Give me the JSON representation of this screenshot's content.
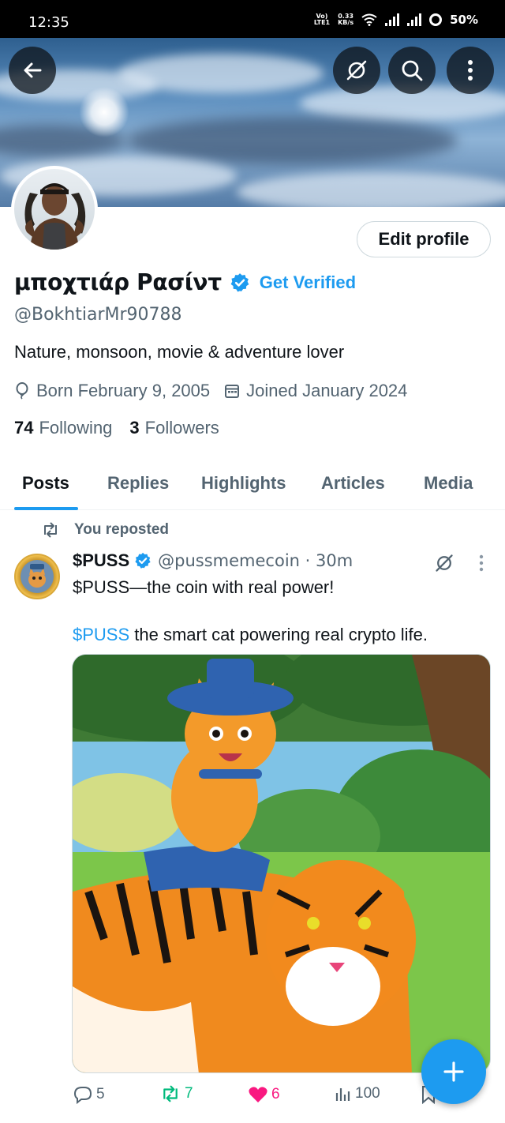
{
  "status_bar": {
    "time": "12:35",
    "network_top": "Vo)",
    "network_bottom": "LTE1",
    "speed_top": "0.33",
    "speed_bottom": "KB/s",
    "battery": "50%"
  },
  "header_buttons": {
    "back": "back-arrow-icon",
    "grok": "grok-icon",
    "search": "search-icon",
    "more": "more-vertical-icon"
  },
  "profile": {
    "edit_label": "Edit profile",
    "display_name": "μποχτιάρ Ρασίντ",
    "get_verified": "Get Verified",
    "handle": "@BokhtiarMr90788",
    "bio": "Nature, monsoon, movie & adventure lover",
    "born": "Born February 9, 2005",
    "joined": "Joined January 2024",
    "following_count": "74",
    "following_label": "Following",
    "followers_count": "3",
    "followers_label": "Followers"
  },
  "tabs": [
    "Posts",
    "Replies",
    "Highlights",
    "Articles",
    "Media"
  ],
  "post": {
    "repost_label": "You reposted",
    "author": "$PUSS",
    "handle_time": "@pussmemecoin · 30m",
    "text_line1": "$PUSS—the coin with real power!",
    "text_cashtag": "$PUSS",
    "text_line2_rest": " the smart cat powering real crypto life.",
    "replies": "5",
    "reposts": "7",
    "likes": "6",
    "views": "100"
  },
  "colors": {
    "accent": "#1d9bf0",
    "repost_green": "#00ba7c",
    "like_pink": "#f91880",
    "secondary_text": "#536471"
  }
}
